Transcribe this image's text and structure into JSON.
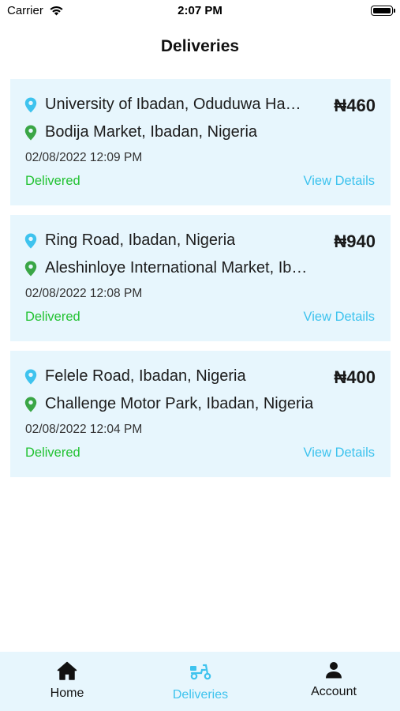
{
  "status_bar": {
    "carrier": "Carrier",
    "time": "2:07 PM"
  },
  "header": {
    "title": "Deliveries"
  },
  "deliveries": [
    {
      "pickup": "University of Ibadan, Oduduwa Hall, Ibadan, Nigeria",
      "dropoff": "Bodija Market, Ibadan, Nigeria",
      "price": "₦460",
      "datetime": "02/08/2022 12:09 PM",
      "status": "Delivered",
      "action": "View Details"
    },
    {
      "pickup": "Ring Road, Ibadan, Nigeria",
      "dropoff": "Aleshinloye International Market, Ibadan, Nigeria",
      "price": "₦940",
      "datetime": "02/08/2022 12:08 PM",
      "status": "Delivered",
      "action": "View Details"
    },
    {
      "pickup": "Felele Road, Ibadan, Nigeria",
      "dropoff": "Challenge Motor Park, Ibadan, Nigeria",
      "price": "₦400",
      "datetime": "02/08/2022 12:04 PM",
      "status": "Delivered",
      "action": "View Details"
    }
  ],
  "tabs": [
    {
      "label": "Home",
      "icon": "home-icon",
      "active": false
    },
    {
      "label": "Deliveries",
      "icon": "scooter-icon",
      "active": true
    },
    {
      "label": "Account",
      "icon": "person-icon",
      "active": false
    }
  ],
  "colors": {
    "card_bg": "#e7f6fd",
    "accent": "#3ec3ee",
    "delivered": "#22c232",
    "pickup_pin": "#3ec3ee",
    "dropoff_pin": "#3aa646"
  }
}
